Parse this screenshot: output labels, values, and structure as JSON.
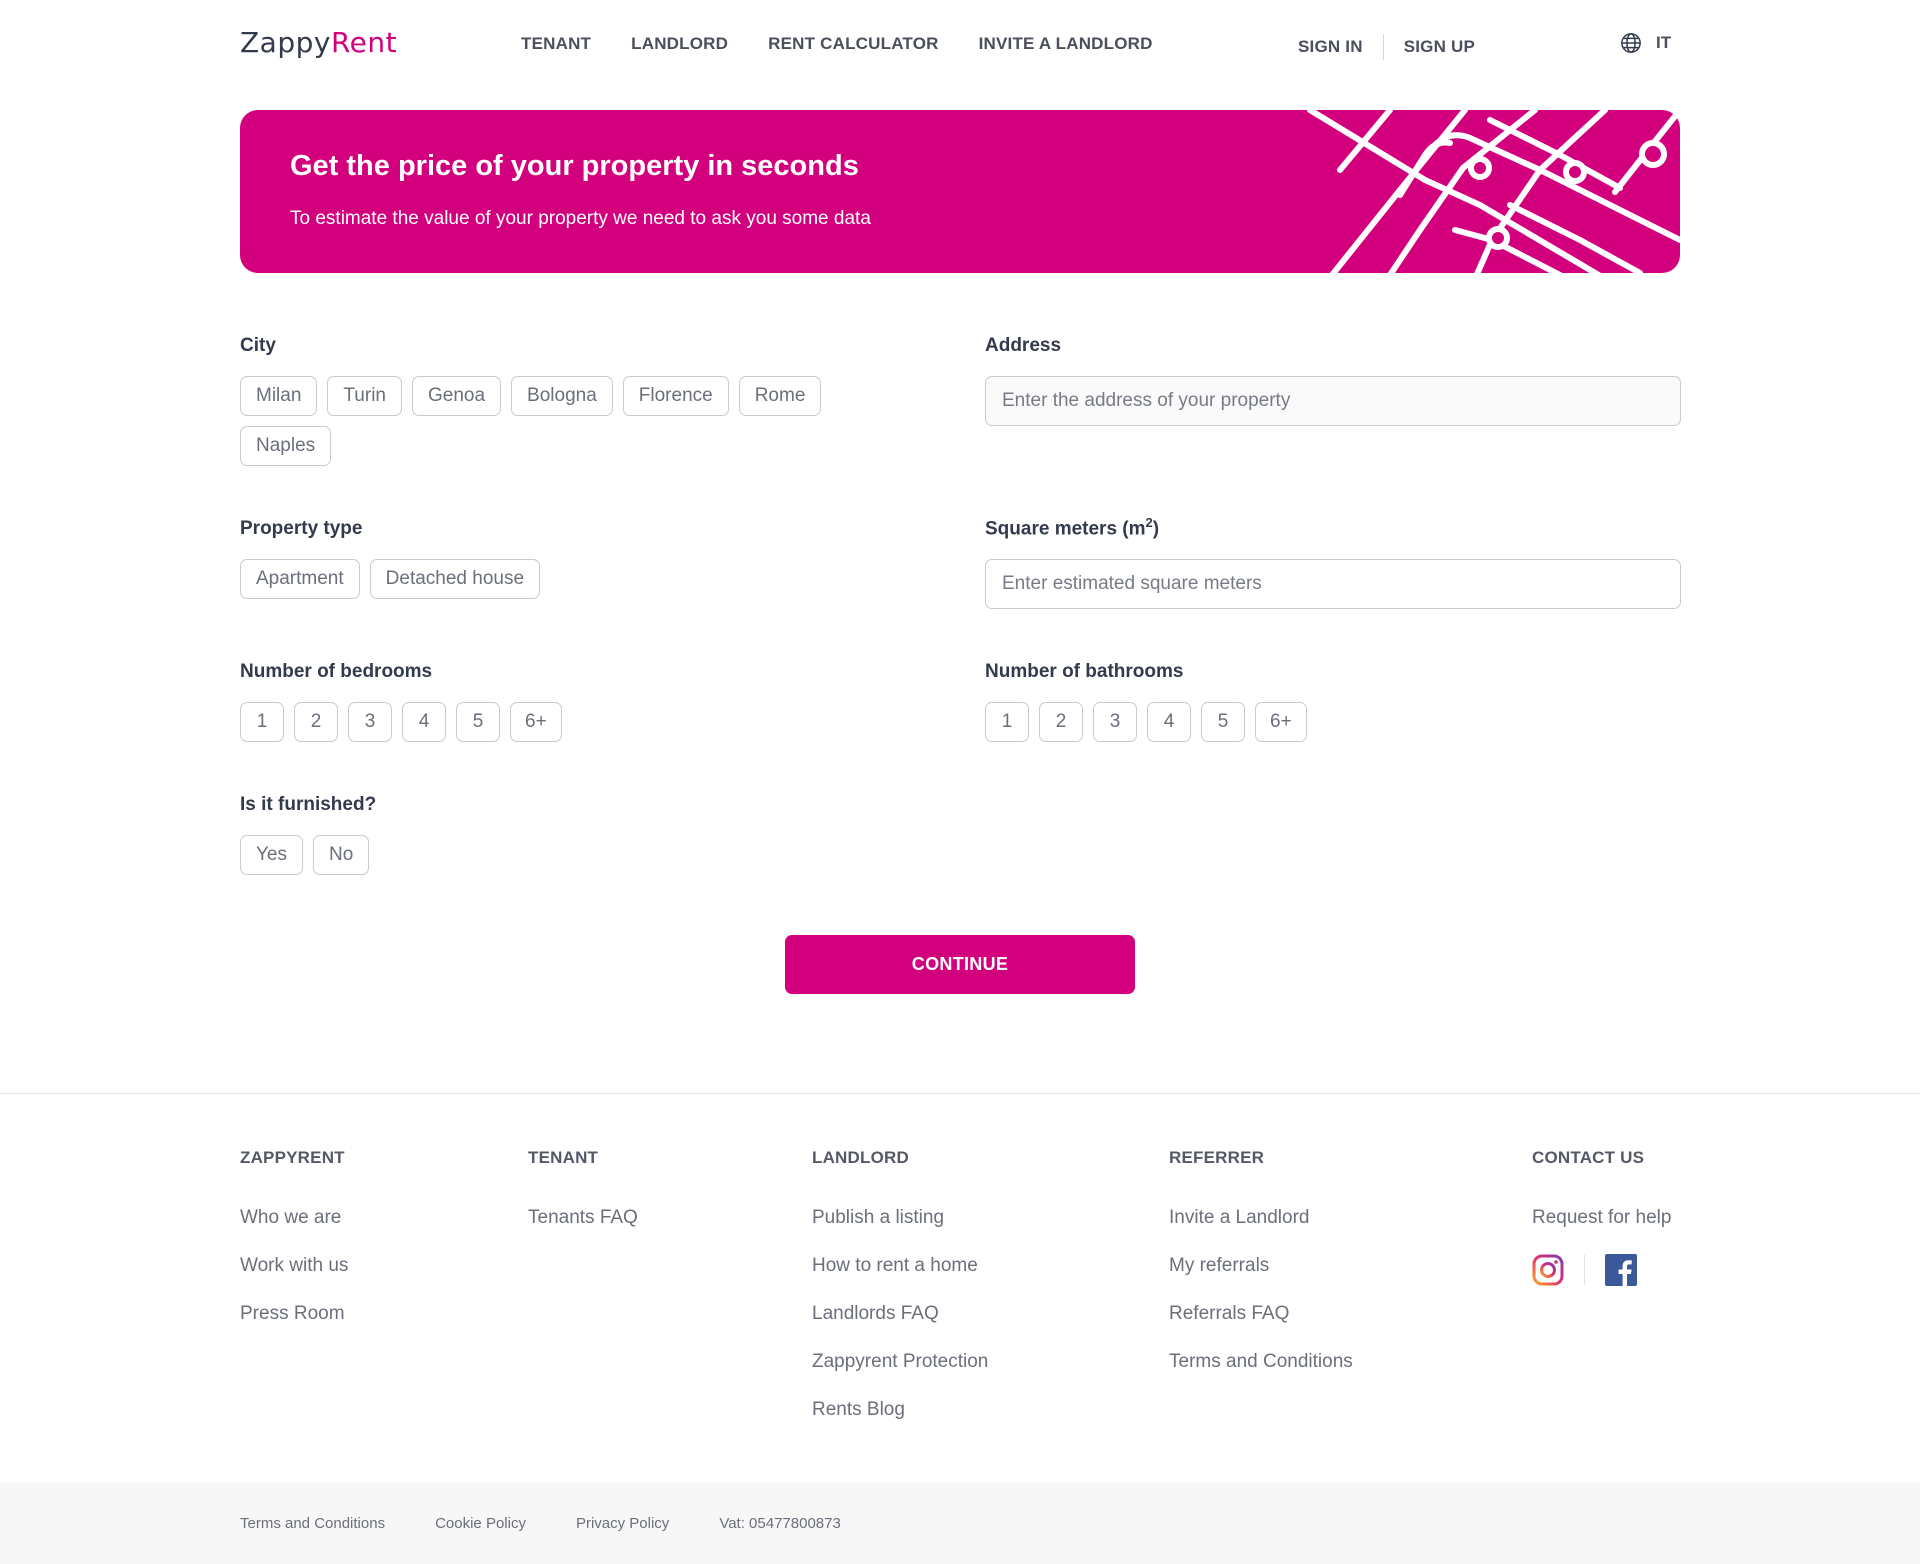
{
  "header": {
    "logo_main": "Zappy",
    "logo_accent": "Rent",
    "nav": [
      "TENANT",
      "LANDLORD",
      "RENT CALCULATOR",
      "INVITE A LANDLORD"
    ],
    "sign_in": "SIGN IN",
    "sign_up": "SIGN UP",
    "language": "IT"
  },
  "banner": {
    "title": "Get the price of your property in seconds",
    "subtitle": "To estimate the value of your property we need to ask you some data"
  },
  "form": {
    "city_label": "City",
    "cities": [
      "Milan",
      "Turin",
      "Genoa",
      "Bologna",
      "Florence",
      "Rome",
      "Naples"
    ],
    "address_label": "Address",
    "address_placeholder": "Enter the address of your property",
    "property_type_label": "Property type",
    "property_types": [
      "Apartment",
      "Detached house"
    ],
    "sqm_label": "Square meters (m",
    "sqm_sup": "2",
    "sqm_label_end": ")",
    "sqm_placeholder": "Enter estimated square meters",
    "bedrooms_label": "Number of bedrooms",
    "bedrooms": [
      "1",
      "2",
      "3",
      "4",
      "5",
      "6+"
    ],
    "bathrooms_label": "Number of bathrooms",
    "bathrooms": [
      "1",
      "2",
      "3",
      "4",
      "5",
      "6+"
    ],
    "furnished_label": "Is it furnished?",
    "furnished": [
      "Yes",
      "No"
    ],
    "continue_label": "CONTINUE"
  },
  "footer": {
    "columns": [
      {
        "title": "ZAPPYRENT",
        "links": [
          "Who we are",
          "Work with us",
          "Press Room"
        ]
      },
      {
        "title": "TENANT",
        "links": [
          "Tenants FAQ"
        ]
      },
      {
        "title": "LANDLORD",
        "links": [
          "Publish a listing",
          "How to rent a home",
          "Landlords FAQ",
          "Zappyrent Protection",
          "Rents Blog"
        ]
      },
      {
        "title": "REFERRER",
        "links": [
          "Invite a Landlord",
          "My referrals",
          "Referrals FAQ",
          "Terms and Conditions"
        ]
      },
      {
        "title": "CONTACT US",
        "links": [
          "Request for help"
        ]
      }
    ],
    "bottom": {
      "terms": "Terms and Conditions",
      "cookie": "Cookie Policy",
      "privacy": "Privacy Policy",
      "vat": "Vat: 05477800873"
    }
  },
  "colors": {
    "brand": "#d3007d",
    "text": "#333a4d",
    "instagram": "#e1306c",
    "facebook": "#3b5998"
  }
}
